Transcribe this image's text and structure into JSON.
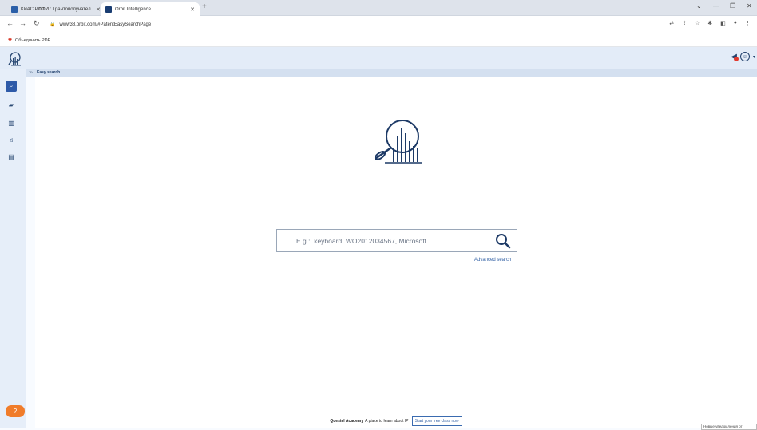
{
  "browser": {
    "tabs": [
      {
        "title": "КИАС РФФИ : Грантополучател",
        "favicon": "kias-icon",
        "color": "#2b5fa8"
      },
      {
        "title": "Orbit Intelligence",
        "favicon": "orbit-icon",
        "color": "#1a3d72"
      }
    ],
    "new_tab": "+",
    "url": "www38.orbit.com/#PatentEasySearchPage",
    "bookmark": "Объединить PDF"
  },
  "app": {
    "section_tab": "Easy search",
    "search": {
      "placeholder": "E.g.:  keyboard, WO2012034567, Microsoft",
      "advanced_link": "Advanced search"
    },
    "footer": {
      "brand": "Questel Academy",
      "tagline": "A place to learn about IP",
      "cta": "Start your free class now"
    },
    "corner_note": "Новые уведомления от"
  },
  "colors": {
    "accent": "#2e5aa8",
    "header_bg": "#e3ecf8",
    "help": "#f07c2a",
    "alert": "#e23a2f"
  }
}
